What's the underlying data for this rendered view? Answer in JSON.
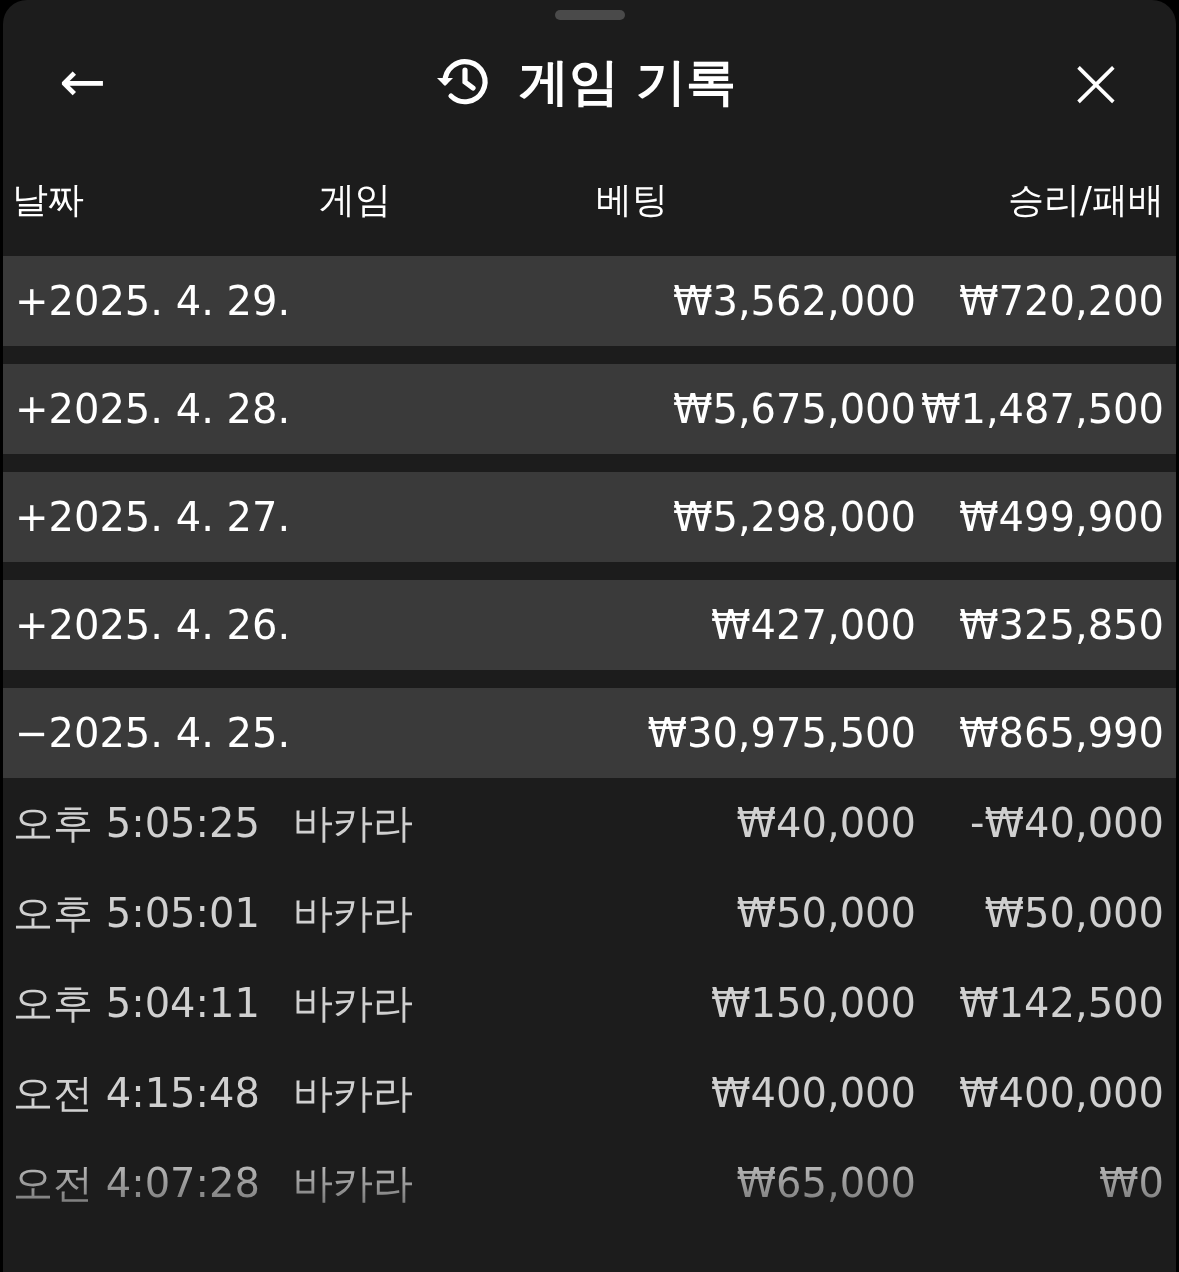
{
  "header": {
    "back": "←",
    "title": "게임 기록",
    "close": "×"
  },
  "columns": [
    "날짜",
    "게임",
    "베팅",
    "승리/패배"
  ],
  "days": [
    {
      "sign": "+",
      "date": "2025. 4. 29.",
      "bet": "₩3,562,000",
      "result": "₩720,200",
      "expanded": false
    },
    {
      "sign": "+",
      "date": "2025. 4. 28.",
      "bet": "₩5,675,000",
      "result": "₩1,487,500",
      "expanded": false
    },
    {
      "sign": "+",
      "date": "2025. 4. 27.",
      "bet": "₩5,298,000",
      "result": "₩499,900",
      "expanded": false
    },
    {
      "sign": "+",
      "date": "2025. 4. 26.",
      "bet": "₩427,000",
      "result": "₩325,850",
      "expanded": false
    },
    {
      "sign": "−",
      "date": "2025. 4. 25.",
      "bet": "₩30,975,500",
      "result": "₩865,990",
      "expanded": true,
      "entries": [
        {
          "time": "오후 5:05:25",
          "game": "바카라",
          "bet": "₩40,000",
          "result": "-₩40,000"
        },
        {
          "time": "오후 5:05:01",
          "game": "바카라",
          "bet": "₩50,000",
          "result": "₩50,000"
        },
        {
          "time": "오후 5:04:11",
          "game": "바카라",
          "bet": "₩150,000",
          "result": "₩142,500"
        },
        {
          "time": "오전 4:15:48",
          "game": "바카라",
          "bet": "₩400,000",
          "result": "₩400,000"
        },
        {
          "time": "오전 4:07:28",
          "game": "바카라",
          "bet": "₩65,000",
          "result": "₩0"
        }
      ]
    }
  ]
}
